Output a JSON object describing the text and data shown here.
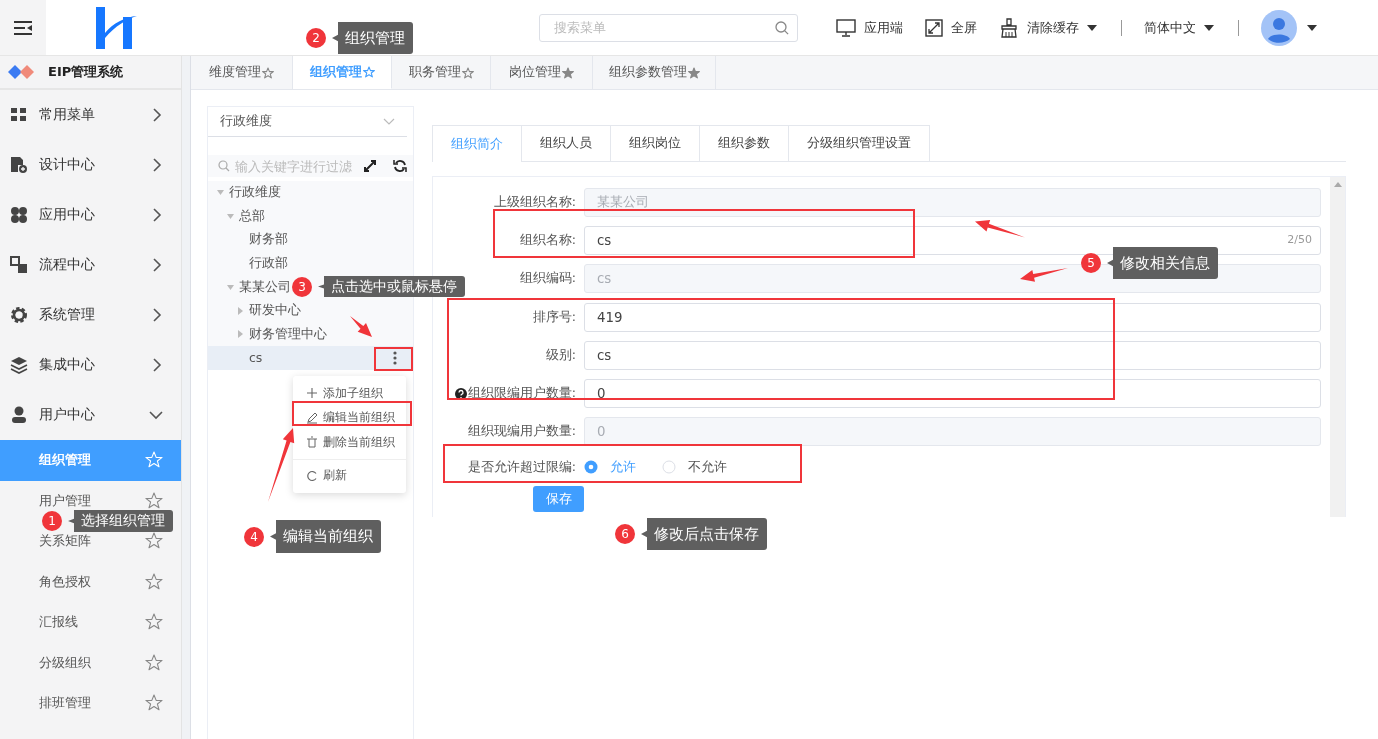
{
  "header": {
    "search": {
      "placeholder": "搜索菜单"
    },
    "actions": [
      {
        "label": "应用端",
        "dropdown": false
      },
      {
        "label": "全屏",
        "dropdown": false
      },
      {
        "label": "清除缓存",
        "dropdown": true
      }
    ],
    "language": "简体中文"
  },
  "sidebar": {
    "title": "EIP管理系统",
    "groups": [
      {
        "label": "常用菜单",
        "expanded": false
      },
      {
        "label": "设计中心",
        "expanded": false
      },
      {
        "label": "应用中心",
        "expanded": false
      },
      {
        "label": "流程中心",
        "expanded": false
      },
      {
        "label": "系统管理",
        "expanded": false
      },
      {
        "label": "集成中心",
        "expanded": false
      },
      {
        "label": "用户中心",
        "expanded": true,
        "items": [
          {
            "label": "组织管理",
            "selected": true
          },
          {
            "label": "用户管理",
            "selected": false
          },
          {
            "label": "关系矩阵",
            "selected": false
          },
          {
            "label": "角色授权",
            "selected": false
          },
          {
            "label": "汇报线",
            "selected": false
          },
          {
            "label": "分级组织",
            "selected": false
          },
          {
            "label": "排班管理",
            "selected": false
          }
        ]
      }
    ]
  },
  "page_tabs": [
    {
      "label": "维度管理",
      "selected": false,
      "starred": false
    },
    {
      "label": "组织管理",
      "selected": true,
      "starred": false
    },
    {
      "label": "职务管理",
      "selected": false,
      "starred": false
    },
    {
      "label": "岗位管理",
      "selected": false,
      "starred": true
    },
    {
      "label": "组织参数管理",
      "selected": false,
      "starred": true
    }
  ],
  "tree": {
    "dimension": "行政维度",
    "filter_placeholder": "输入关键字进行过滤",
    "nodes": [
      {
        "label": "行政维度",
        "expanded": true,
        "selected": false,
        "children": [
          {
            "label": "总部",
            "expanded": true,
            "selected": false,
            "children": [
              {
                "label": "财务部",
                "selected": false
              },
              {
                "label": "行政部",
                "selected": false
              }
            ]
          },
          {
            "label": "某某公司",
            "expanded": true,
            "selected": false,
            "children": [
              {
                "label": "研发中心",
                "expanded": false,
                "selected": false
              },
              {
                "label": "财务管理中心",
                "expanded": false,
                "selected": false
              },
              {
                "label": "cs",
                "selected": true
              }
            ]
          }
        ]
      }
    ],
    "context_menu": [
      {
        "label": "添加子组织",
        "kind": "add"
      },
      {
        "label": "编辑当前组织",
        "kind": "edit"
      },
      {
        "label": "删除当前组织",
        "kind": "delete"
      },
      {
        "label": "刷新",
        "kind": "refresh"
      }
    ]
  },
  "form_tabs": [
    {
      "label": "组织简介",
      "selected": true
    },
    {
      "label": "组织人员",
      "selected": false
    },
    {
      "label": "组织岗位",
      "selected": false
    },
    {
      "label": "组织参数",
      "selected": false
    },
    {
      "label": "分级组织管理设置",
      "selected": false
    }
  ],
  "form": {
    "fields": [
      {
        "label": "上级组织名称:",
        "value": "某某公司",
        "disabled": true
      },
      {
        "label": "组织名称:",
        "value": "cs",
        "disabled": false,
        "counter": "2/50"
      },
      {
        "label": "组织编码:",
        "value": "cs",
        "disabled": true
      },
      {
        "label": "排序号:",
        "value": "419",
        "disabled": false
      },
      {
        "label": "级别:",
        "value": "cs",
        "disabled": false
      },
      {
        "label": "组织限编用户数量:",
        "value": "0",
        "disabled": false,
        "help": true
      },
      {
        "label": "组织现编用户数量:",
        "value": "0",
        "disabled": true
      }
    ],
    "radio": {
      "label": "是否允许超过限编:",
      "options": [
        {
          "label": "允许",
          "selected": true
        },
        {
          "label": "不允许",
          "selected": false
        }
      ]
    },
    "save": "保存"
  },
  "callouts": [
    {
      "number": "1",
      "text": "选择组织管理"
    },
    {
      "number": "2",
      "text": "组织管理"
    },
    {
      "number": "3",
      "text": "点击选中或鼠标悬停"
    },
    {
      "number": "4",
      "text": "编辑当前组织"
    },
    {
      "number": "5",
      "text": "修改相关信息"
    },
    {
      "number": "6",
      "text": "修改后点击保存"
    }
  ]
}
